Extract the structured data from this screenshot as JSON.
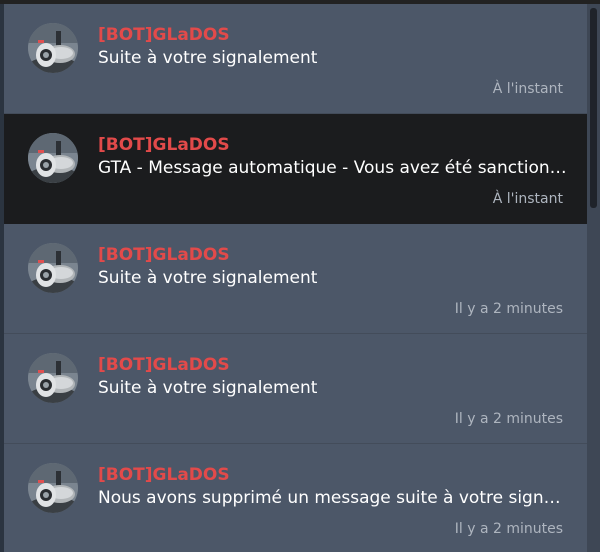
{
  "notifications": [
    {
      "sender": "[BOT]GLaDOS",
      "message": "Suite à votre signalement",
      "time": "À l'instant"
    },
    {
      "sender": "[BOT]GLaDOS",
      "message": "GTA - Message automatique - Vous avez été sanctionné",
      "time": "À l'instant"
    },
    {
      "sender": "[BOT]GLaDOS",
      "message": "Suite à votre signalement",
      "time": "Il y a 2 minutes"
    },
    {
      "sender": "[BOT]GLaDOS",
      "message": "Suite à votre signalement",
      "time": "Il y a 2 minutes"
    },
    {
      "sender": "[BOT]GLaDOS",
      "message": "Nous avons supprimé un message suite à votre signalement",
      "time": "Il y a 2 minutes"
    }
  ],
  "colors": {
    "sender": "#e24a4a",
    "item_bg": "#4c5768",
    "active_bg": "#1b1c1e",
    "time": "#aeb5bf"
  },
  "icons": {
    "avatar": "robot-avatar-icon"
  }
}
